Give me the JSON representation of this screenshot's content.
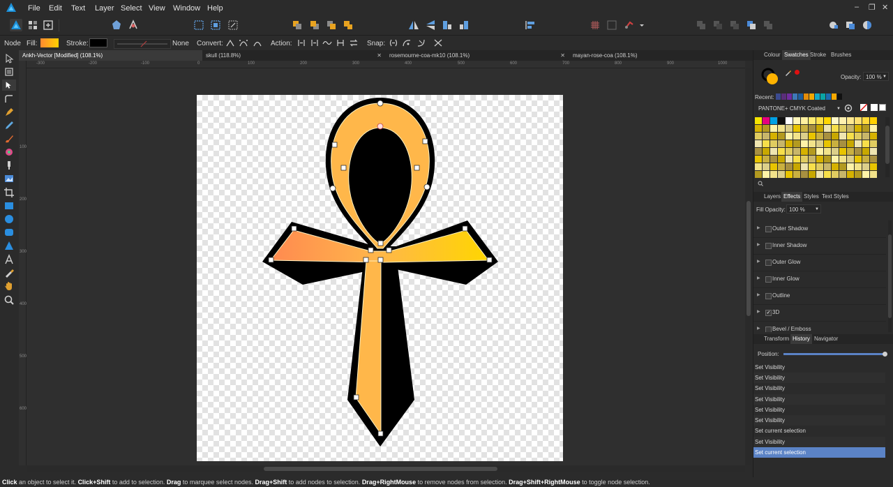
{
  "menu": [
    "File",
    "Edit",
    "Text",
    "Layer",
    "Select",
    "View",
    "Window",
    "Help"
  ],
  "window_controls": {
    "minimize": "–",
    "restore": "❐",
    "close": "✕"
  },
  "context": {
    "tool_name": "Node",
    "fill_label": "Fill:",
    "stroke_label": "Stroke:",
    "stroke_value": "None",
    "convert_label": "Convert:",
    "action_label": "Action:",
    "snap_label": "Snap:",
    "fill_color": "#ffb300",
    "stroke_color": "#000000"
  },
  "tabs": [
    {
      "label": "Ankh-Vector [Modified] (108.1%)"
    },
    {
      "label": "skull (118.8%)"
    },
    {
      "label": "rosemourne-coa-mk10 (108.1%)"
    },
    {
      "label": "mayan-rose-coa (108.1%)"
    }
  ],
  "ruler_h": [
    "-300",
    "-200",
    "-100",
    "0",
    "100",
    "200",
    "300",
    "400",
    "500",
    "600",
    "700",
    "800",
    "900",
    "1000"
  ],
  "ruler_v": [
    "100",
    "200",
    "300",
    "400",
    "500",
    "600"
  ],
  "color_panel": {
    "tabs": [
      "Colour",
      "Swatches",
      "Stroke",
      "Brushes"
    ],
    "active_tab": "Swatches",
    "opacity_label": "Opacity:",
    "opacity_value": "100 %",
    "recent_label": "Recent:",
    "palette_name": "PANTONE+ CMYK Coated",
    "recent_colors": [
      "#3b4a8f",
      "#5a2e7a",
      "#6f2c9e",
      "#3e78b8",
      "#1f5e9c",
      "#e38c0a",
      "#f2a800",
      "#14a8c4",
      "#0aa5a5",
      "#1d6bb0",
      "#f5a800",
      "#111111"
    ],
    "swatch_first_row": [
      "#f5e400",
      "#e6007e",
      "#00a0e4",
      "#111111",
      "#ffffff",
      "#fff5b8",
      "#fff0a0",
      "#ffeb70",
      "#ffe24a",
      "#ffd600",
      "#fff8c8",
      "#fff0b0",
      "#ffe890",
      "#ffe070",
      "#ffda3c",
      "#ffd000"
    ]
  },
  "effects_panel": {
    "tabs": [
      "Layers",
      "Effects",
      "Styles",
      "Text Styles"
    ],
    "active_tab": "Effects",
    "fill_opacity_label": "Fill Opacity:",
    "fill_opacity_value": "100 %",
    "items": [
      {
        "name": "Outer Shadow",
        "checked": false
      },
      {
        "name": "Inner Shadow",
        "checked": false
      },
      {
        "name": "Outer Glow",
        "checked": false
      },
      {
        "name": "Inner Glow",
        "checked": false
      },
      {
        "name": "Outline",
        "checked": false
      },
      {
        "name": "3D",
        "checked": true
      },
      {
        "name": "Bevel / Emboss",
        "checked": false
      }
    ]
  },
  "history_panel": {
    "tabs": [
      "Transform",
      "History",
      "Navigator"
    ],
    "active_tab": "History",
    "position_label": "Position:",
    "position_value": 1.0,
    "items": [
      "Set Visibility",
      "Set Visibility",
      "Set Visibility",
      "Set Visibility",
      "Set Visibility",
      "Set Visibility",
      "Set current selection",
      "Set Visibility",
      "Set current selection"
    ],
    "selected_index": 8
  },
  "status": {
    "parts": [
      {
        "k": "Click",
        "t": " an object to select it. "
      },
      {
        "k": "Click+Shift",
        "t": " to add to selection. "
      },
      {
        "k": "Drag",
        "t": " to marquee select nodes. "
      },
      {
        "k": "Drag+Shift",
        "t": " to add nodes to selection. "
      },
      {
        "k": "Drag+RightMouse",
        "t": " to remove nodes from selection. "
      },
      {
        "k": "Drag+Shift+RightMouse",
        "t": " to toggle node selection."
      }
    ]
  },
  "colors": {
    "accent": "#5b83c6",
    "gold_light": "#ffb74a",
    "gold": "#ffb300",
    "orange": "#ff8a50",
    "yellow": "#ffd600"
  }
}
